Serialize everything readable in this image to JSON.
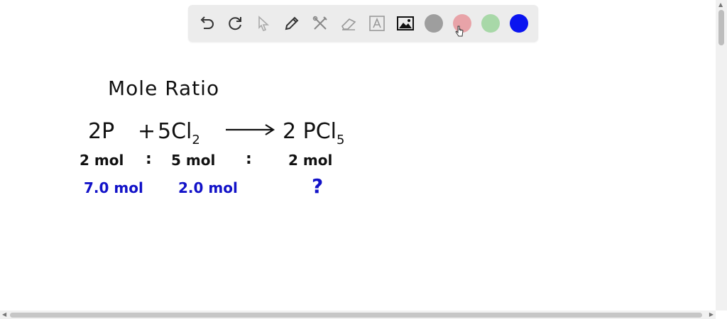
{
  "toolbar": {
    "tools": [
      {
        "name": "undo-icon"
      },
      {
        "name": "redo-icon"
      },
      {
        "name": "select-icon"
      },
      {
        "name": "pen-icon"
      },
      {
        "name": "tools-icon"
      },
      {
        "name": "eraser-icon"
      },
      {
        "name": "text-icon"
      },
      {
        "name": "image-icon"
      }
    ],
    "colors": [
      "#9e9e9e",
      "#e8a3a8",
      "#a8d8a8",
      "#0a14f0"
    ]
  },
  "canvas": {
    "title": "Mole Ratio",
    "equation": {
      "reactant1": "2P",
      "plus": "+",
      "reactant2_main": "5Cl",
      "reactant2_sub": "2",
      "product_main": "2 PCl",
      "product_sub": "5"
    },
    "ratio": {
      "r1": "2 mol",
      "sep1": ":",
      "r2": "5 mol",
      "sep2": ":",
      "p": "2 mol"
    },
    "given": {
      "r1": "7.0 mol",
      "r2": "2.0 mol",
      "unknown": "?"
    }
  }
}
